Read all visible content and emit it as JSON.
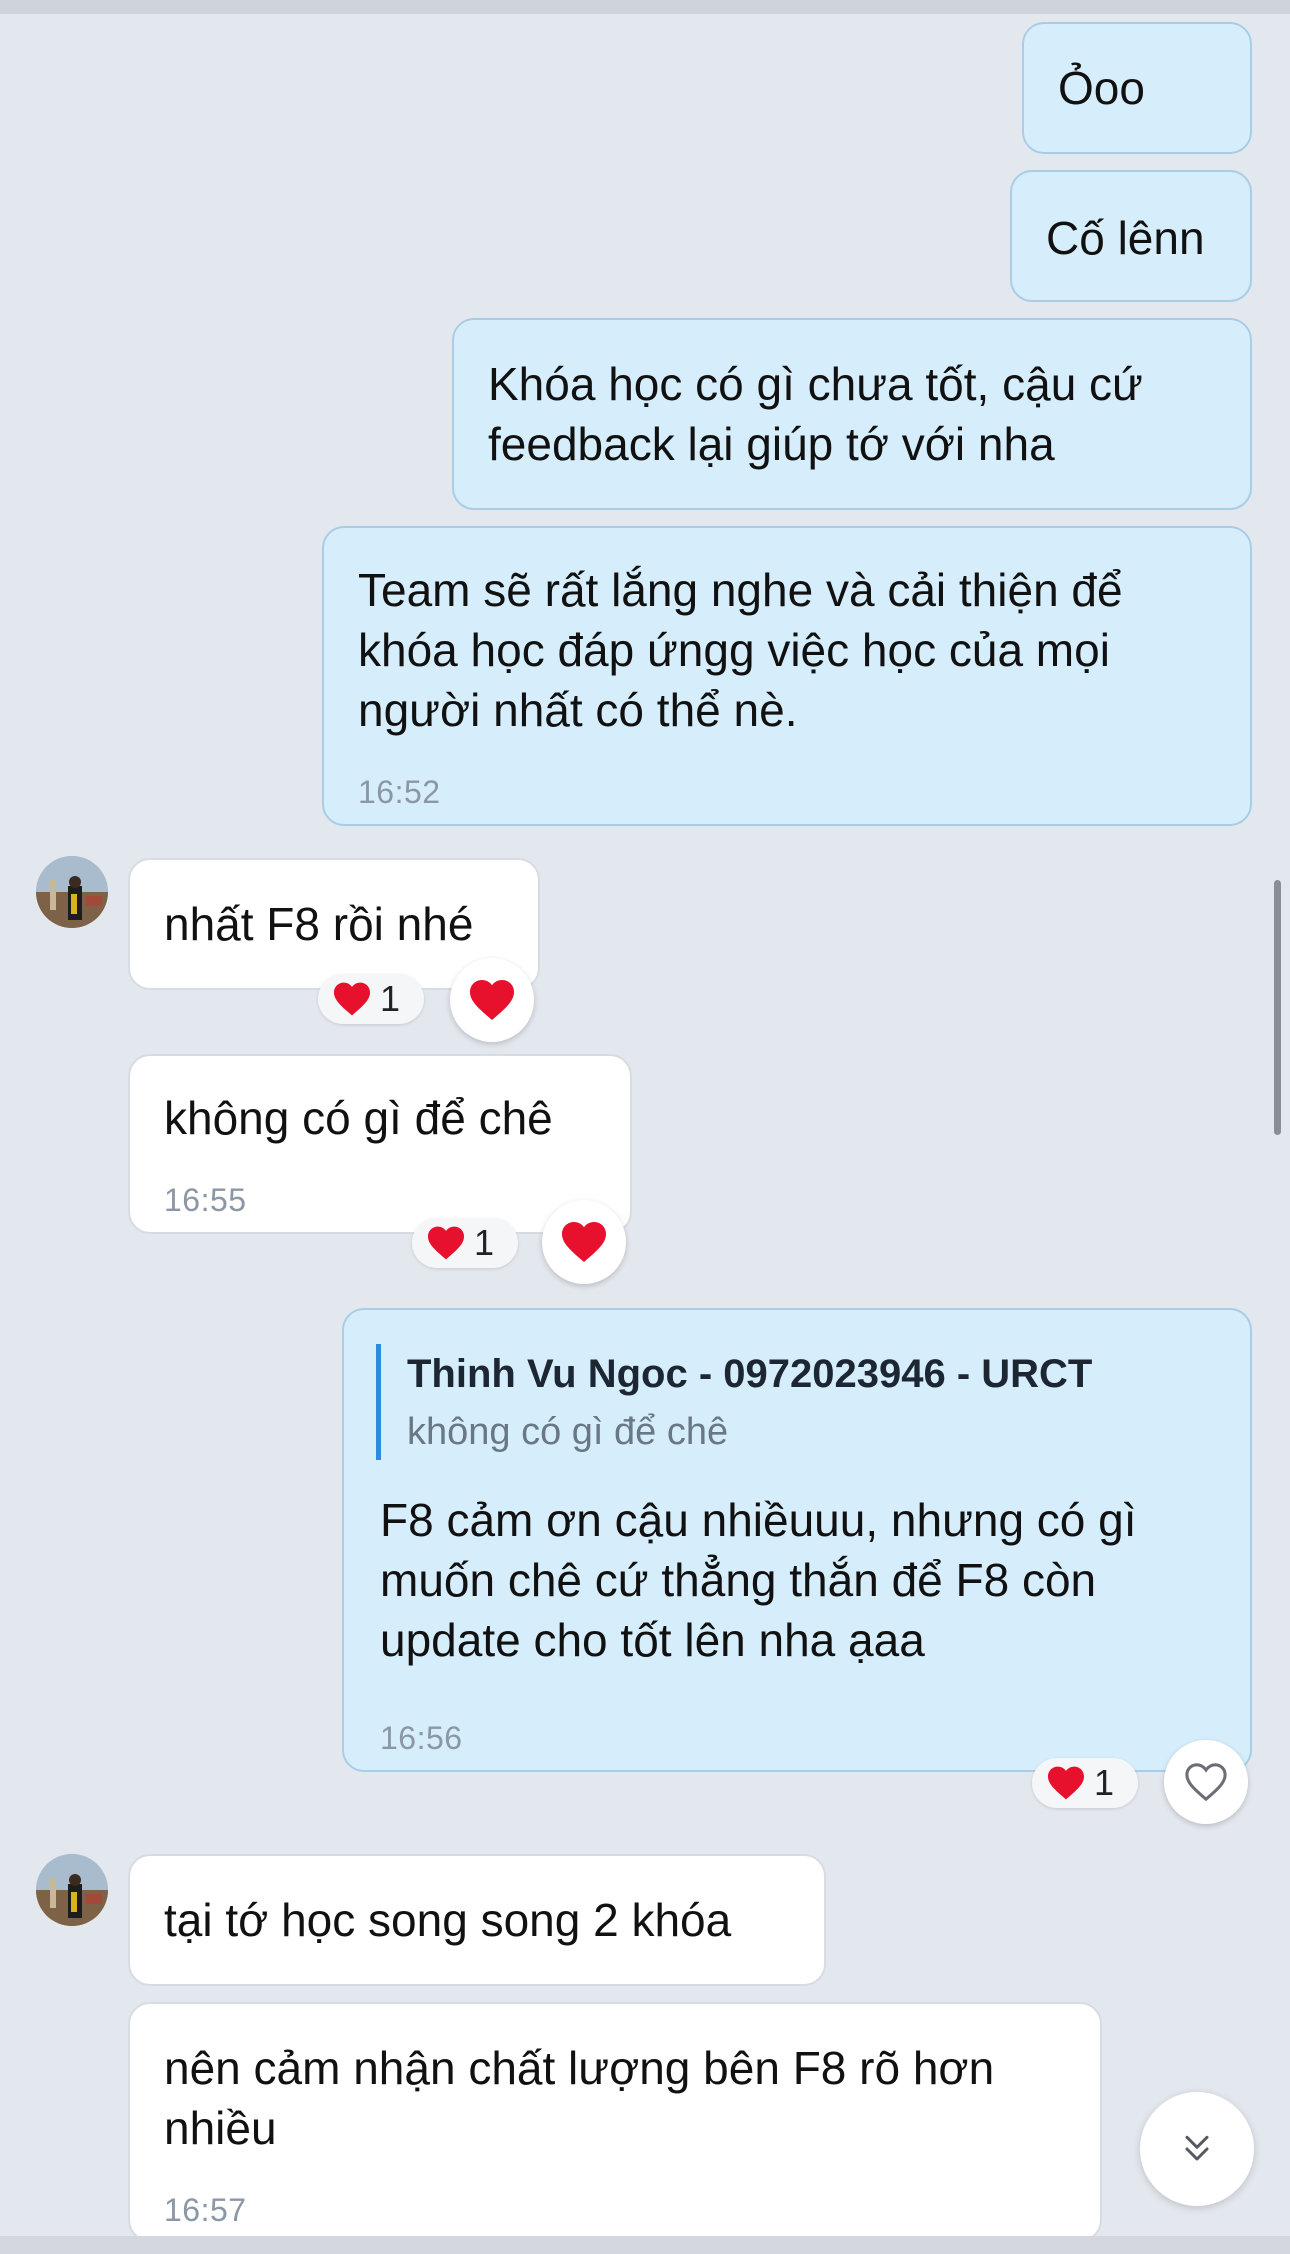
{
  "messages": [
    {
      "text": "Ỏoo"
    },
    {
      "text": "Cố lênn"
    },
    {
      "text": "Khóa học có gì chưa tốt, cậu cứ\nfeedback lại giúp tớ với nha"
    },
    {
      "text": "Team sẽ rất lắng nghe và cải thiện để\nkhóa học đáp ứngg việc học của mọi\nngười nhất có thể nè.",
      "time": "16:52"
    },
    {
      "text": "nhất F8 rồi nhé",
      "reaction_count": "1"
    },
    {
      "text": "không có gì để chê",
      "time": "16:55",
      "reaction_count": "1"
    },
    {
      "quote_author": "Thinh Vu Ngoc - 0972023946 - URCT",
      "quote_text": "không có gì để chê",
      "text": "F8 cảm ơn cậu nhiềuuu, nhưng có gì\nmuốn chê cứ thẳng thắn để F8 còn\nupdate cho tốt lên nha ạaa",
      "time": "16:56",
      "reaction_count": "1"
    },
    {
      "text": "tại tớ học song song 2 khóa"
    },
    {
      "text": "nên cảm nhận chất lượng bên F8 rõ hơn\nnhiều",
      "time": "16:57"
    }
  ],
  "icons": {
    "reaction": "heart-icon",
    "react_button_filled": "heart-filled-icon",
    "react_button_outline": "heart-outline-icon",
    "scroll_down": "double-chevron-down-icon"
  },
  "colors": {
    "background": "#e3e7ee",
    "outgoing_bubble": "#d6eefc",
    "incoming_bubble": "#ffffff",
    "heart": "#e8112d",
    "quote_bar": "#2b8be0"
  }
}
